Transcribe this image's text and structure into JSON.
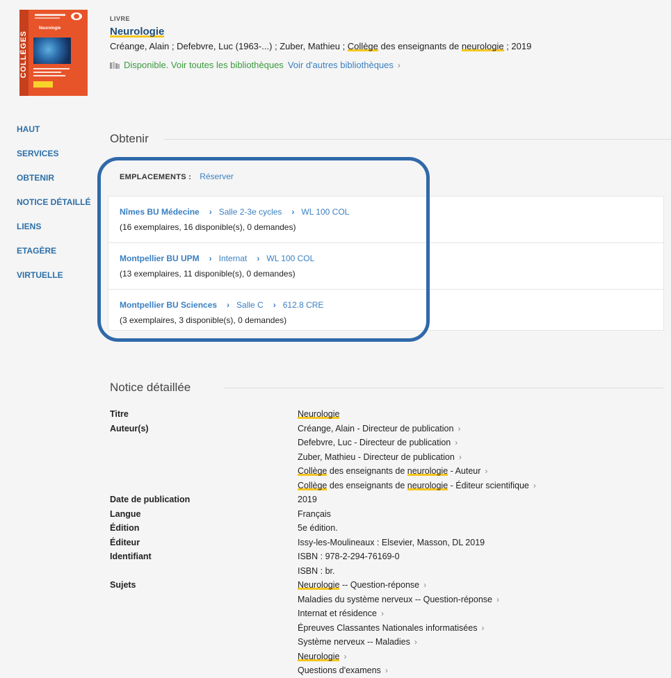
{
  "record": {
    "type": "LIVRE",
    "title": "Neurologie",
    "authors_line": {
      "before": "Créange, Alain ; Defebvre, Luc (1963-...) ; Zuber, Mathieu ; ",
      "hl1": "Collège",
      "mid": " des enseignants de ",
      "hl2": "neurologie",
      "after": " ; 2019"
    },
    "availability": "Disponible. Voir toutes les bibliothèques",
    "other_libraries": "Voir d'autres bibliothèques",
    "cover": {
      "band_text": "COLLÈGES",
      "cover_title": "Neurologie"
    }
  },
  "nav": [
    "HAUT",
    "SERVICES",
    "OBTENIR",
    "NOTICE DÉTAILLÉ",
    "LIENS",
    "ETAGÈRE",
    "VIRTUELLE"
  ],
  "obtain": {
    "title": "Obtenir",
    "locations_label": "EMPLACEMENTS :",
    "reserve": "Réserver",
    "locations": [
      {
        "library": "Nîmes BU Médecine",
        "room": "Salle 2-3e cycles",
        "callno": "WL 100 COL",
        "info": "(16 exemplaires, 16 disponible(s), 0 demandes)"
      },
      {
        "library": "Montpellier BU UPM",
        "room": "Internat",
        "callno": "WL 100 COL",
        "info": "(13 exemplaires, 11 disponible(s), 0 demandes)"
      },
      {
        "library": "Montpellier BU Sciences",
        "room": "Salle C",
        "callno": "612.8 CRE",
        "info": "(3 exemplaires, 3 disponible(s), 0 demandes)"
      }
    ]
  },
  "details": {
    "title": "Notice détaillée",
    "rows": [
      {
        "label": "Titre",
        "values": [
          {
            "hl": "Neurologie",
            "rest": "",
            "link": false
          }
        ]
      },
      {
        "label": "Auteur(s)",
        "values": [
          {
            "pre": "Créange, Alain - Directeur de publication",
            "link": true
          },
          {
            "pre": "Defebvre, Luc - Directeur de publication",
            "link": true
          },
          {
            "pre": "Zuber, Mathieu - Directeur de publication",
            "link": true
          },
          {
            "hl": "Collège",
            "mid": " des enseignants de ",
            "hl2": "neurologie",
            "rest": " - Auteur",
            "link": true
          },
          {
            "hl": "Collège",
            "mid": " des enseignants de ",
            "hl2": "neurologie",
            "rest": " - Éditeur scientifique",
            "link": true
          }
        ]
      },
      {
        "label": "Date de publication",
        "values": [
          {
            "pre": "2019",
            "link": false
          }
        ]
      },
      {
        "label": "Langue",
        "values": [
          {
            "pre": "Français",
            "link": false
          }
        ]
      },
      {
        "label": "Édition",
        "values": [
          {
            "pre": "5e édition.",
            "link": false
          }
        ]
      },
      {
        "label": "Éditeur",
        "values": [
          {
            "pre": "Issy-les-Moulineaux : Elsevier, Masson, DL 2019",
            "link": false
          }
        ]
      },
      {
        "label": "Identifiant",
        "values": [
          {
            "pre": "ISBN : 978-2-294-76169-0",
            "link": false
          },
          {
            "pre": "ISBN : br.",
            "link": false
          }
        ]
      },
      {
        "label": "Sujets",
        "values": [
          {
            "hl": "Neurologie",
            "rest": " -- Question-réponse",
            "link": true
          },
          {
            "pre": "Maladies du système nerveux -- Question-réponse",
            "link": true
          },
          {
            "pre": "Internat et résidence",
            "link": true
          },
          {
            "pre": "Épreuves Classantes Nationales informatisées",
            "link": true
          },
          {
            "pre": "Système nerveux -- Maladies",
            "link": true
          },
          {
            "hl": "Neurologie",
            "rest": "",
            "link": true
          },
          {
            "pre": "Questions d'examens",
            "link": true
          }
        ]
      }
    ]
  }
}
